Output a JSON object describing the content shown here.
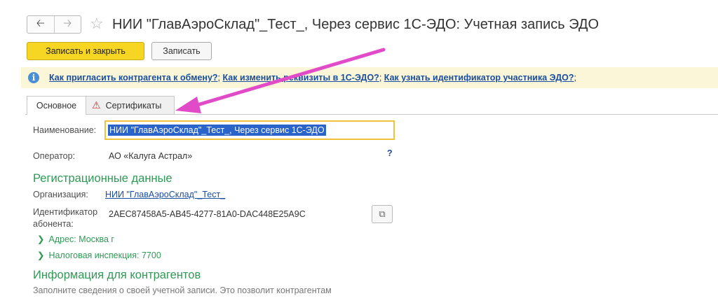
{
  "window": {
    "title": "НИИ \"ГлавАэроСклад\"_Тест_, Через сервис 1С-ЭДО: Учетная запись ЭДО",
    "back_icon": "arrow-left-icon",
    "forward_icon": "arrow-right-icon",
    "favorite_icon": "star-icon"
  },
  "toolbar": {
    "save_close_label": "Записать и закрыть",
    "save_label": "Записать"
  },
  "info_bar": {
    "icon": "info-icon",
    "links": [
      "Как пригласить контрагента к обмену?",
      "Как изменить реквизиты в 1С-ЭДО?",
      "Как узнать идентификатор участника ЭДО?"
    ],
    "separator": ";"
  },
  "tabs": [
    {
      "label": "Основное",
      "active": true
    },
    {
      "label": "Сертификаты",
      "active": false,
      "icon": "warning-icon"
    }
  ],
  "form": {
    "name_label": "Наименование:",
    "name_value": "НИИ \"ГлавАэроСклад\"_Тест_, Через сервис 1С-ЭДО",
    "operator_label": "Оператор:",
    "operator_value": "АО «Калуга Астрал»",
    "help": "?"
  },
  "registration": {
    "title": "Регистрационные данные",
    "org_label": "Организация:",
    "org_value": "НИИ \"ГлавАэроСклад\"_Тест_",
    "id_label_line1": "Идентификатор",
    "id_label_line2": "абонента:",
    "id_value": "2AEC87458A5-AB45-4277-81A0-DAC448E25A9C",
    "address": "Адрес: Москва г",
    "tax": "Налоговая инспекция: 7700"
  },
  "info_section": {
    "title": "Информация для контрагентов",
    "text": "Заполните сведения о своей учетной записи. Это позволит контрагентам"
  },
  "colors": {
    "accent_yellow": "#f6d523",
    "link_blue": "#1a4ea0",
    "section_green": "#2f9a55",
    "annotation_arrow": "#e24bc8"
  }
}
